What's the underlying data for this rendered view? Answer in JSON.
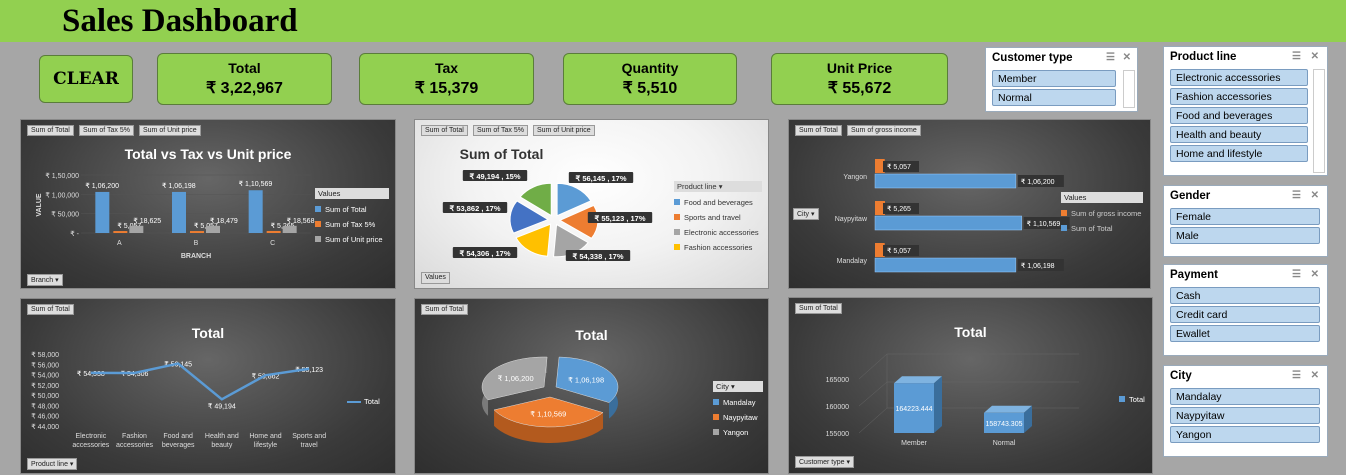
{
  "title": "Sales Dashboard",
  "clear": "CLEAR",
  "kpis": [
    {
      "label": "Total",
      "value": "₹ 3,22,967"
    },
    {
      "label": "Tax",
      "value": "₹ 15,379"
    },
    {
      "label": "Quantity",
      "value": "₹ 5,510"
    },
    {
      "label": "Unit Price",
      "value": "₹ 55,672"
    }
  ],
  "slicers": {
    "customer": {
      "title": "Customer type",
      "items": [
        "Member",
        "Normal"
      ]
    },
    "product": {
      "title": "Product line",
      "items": [
        "Electronic accessories",
        "Fashion accessories",
        "Food and beverages",
        "Health and beauty",
        "Home and lifestyle"
      ]
    },
    "gender": {
      "title": "Gender",
      "items": [
        "Female",
        "Male"
      ]
    },
    "payment": {
      "title": "Payment",
      "items": [
        "Cash",
        "Credit card",
        "Ewallet"
      ]
    },
    "city": {
      "title": "City",
      "items": [
        "Mandalay",
        "Naypyitaw",
        "Yangon"
      ]
    }
  },
  "tabs": {
    "sum_total": "Sum of Total",
    "sum_tax": "Sum of Tax 5%",
    "sum_unit": "Sum of Unit price",
    "sum_gross": "Sum of gross income"
  },
  "colors": {
    "blue": "#5b9bd5",
    "orange": "#ed7d31",
    "gray": "#a5a5a5",
    "yellow": "#ffc000",
    "green": "#70ad47",
    "navy": "#4472c4"
  },
  "chart_data": [
    {
      "type": "bar",
      "title": "Total vs Tax vs Unit price",
      "categories": [
        "A",
        "B",
        "C"
      ],
      "xlabel": "BRANCH",
      "ylabel": "VALUE",
      "ylim": [
        0,
        150000
      ],
      "yticks": [
        "₹ 1,50,000",
        "₹ 1,00,000",
        "₹ 50,000",
        "₹ -"
      ],
      "series": [
        {
          "name": "Sum of Total",
          "values": [
            106200,
            106198,
            110569
          ],
          "labels": [
            "₹ 1,06,200",
            "₹ 1,06,198",
            "₹ 1,10,569"
          ]
        },
        {
          "name": "Sum of Tax 5%",
          "values": [
            5057,
            5057,
            5265
          ],
          "labels": [
            "₹ 5,057",
            "₹ 5,057",
            "₹ 5,265"
          ]
        },
        {
          "name": "Sum of Unit price",
          "values": [
            18625,
            18479,
            18568
          ],
          "labels": [
            "₹ 18,625",
            "₹ 18,479",
            "₹ 18,568"
          ]
        }
      ],
      "legend_title": "Values",
      "filter": "Branch"
    },
    {
      "type": "pie",
      "title": "Sum of Total",
      "legend_title": "Product line",
      "values": [
        56145,
        55123,
        54338,
        54306,
        53862,
        49194
      ],
      "labels": [
        "₹ 56,145 , 17%",
        "₹ 55,123 , 17%",
        "₹ 54,338 , 17%",
        "₹ 54,306 , 17%",
        "₹ 53,862 , 17%",
        "₹ 49,194 , 15%"
      ],
      "legend": [
        "Food and beverages",
        "Sports and travel",
        "Electronic accessories",
        "Fashion accessories"
      ],
      "filter": "Values"
    },
    {
      "type": "bar",
      "title": "",
      "categories": [
        "Yangon",
        "Naypyitaw",
        "Mandalay"
      ],
      "series": [
        {
          "name": "Sum of gross income",
          "values": [
            5057,
            5265,
            5057
          ],
          "labels": [
            "₹ 5,057",
            "₹ 5,265",
            "₹ 5,057"
          ]
        },
        {
          "name": "Sum of Total",
          "values": [
            106200,
            110569,
            106198
          ],
          "labels": [
            "₹ 1,06,200",
            "₹ 1,10,569",
            "₹ 1,06,198"
          ]
        }
      ],
      "legend_title": "Values",
      "filter": "City"
    },
    {
      "type": "line",
      "title": "Total",
      "categories": [
        "Electronic accessories",
        "Fashion accessories",
        "Food and beverages",
        "Health and beauty",
        "Home and lifestyle",
        "Sports and travel"
      ],
      "values": [
        54338,
        54306,
        56145,
        49194,
        53862,
        55123
      ],
      "labels": [
        "₹ 54,338",
        "₹ 54,306",
        "₹ 56,145",
        "₹ 49,194",
        "₹ 53,862",
        "₹ 55,123"
      ],
      "ylim": [
        44000,
        58000
      ],
      "yticks": [
        "₹ 58,000",
        "₹ 56,000",
        "₹ 54,000",
        "₹ 52,000",
        "₹ 50,000",
        "₹ 48,000",
        "₹ 46,000",
        "₹ 44,000"
      ],
      "legend": "Total",
      "filter": "Product line"
    },
    {
      "type": "pie",
      "title": "Total",
      "values": [
        106198,
        110569,
        106200
      ],
      "labels": [
        "₹ 1,06,198",
        "₹ 1,10,569",
        "₹ 1,06,200"
      ],
      "legend_title": "City",
      "legend": [
        "Mandalay",
        "Naypyitaw",
        "Yangon"
      ]
    },
    {
      "type": "bar",
      "title": "Total",
      "categories": [
        "Member",
        "Normal"
      ],
      "values": [
        164223.444,
        158743.305
      ],
      "labels": [
        "164223.444",
        "158743.305"
      ],
      "ylim": [
        155000,
        165000
      ],
      "yticks": [
        "165000",
        "160000",
        "155000"
      ],
      "legend": "Total",
      "filter": "Customer type"
    }
  ]
}
